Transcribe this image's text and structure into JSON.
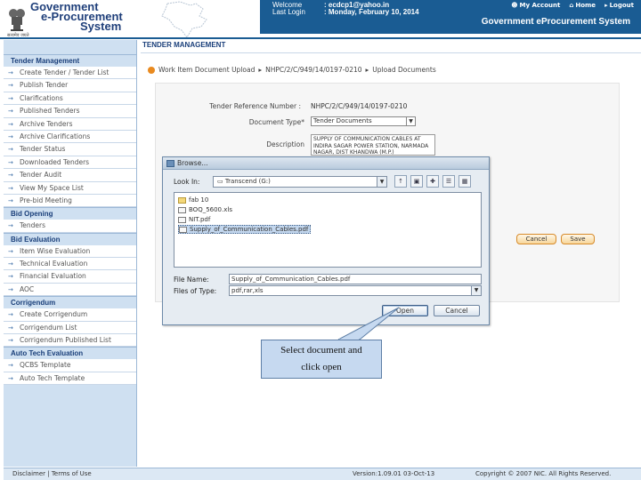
{
  "header": {
    "title_line1": "Government",
    "title_line2": "e-Procurement",
    "title_line3": "System",
    "emblem_caption": "सत्यमेव जयते",
    "welcome_label": "Welcome",
    "welcome_value": ": ecdcp1@yahoo.in",
    "lastlogin_label": "Last Login",
    "lastlogin_value": ": Monday, February 10, 2014",
    "my_account": "My Account",
    "home": "Home",
    "logout": "Logout",
    "system_title": "Government eProcurement System"
  },
  "sidebar": {
    "sections": [
      {
        "title": "Tender Management",
        "items": [
          "Create Tender / Tender List",
          "Publish Tender",
          "Clarifications",
          "Published Tenders",
          "Archive Tenders",
          "Archive Clarifications",
          "Tender Status",
          "Downloaded Tenders",
          "Tender Audit",
          "View My Space List",
          "Pre-bid Meeting"
        ]
      },
      {
        "title": "Bid Opening",
        "items": [
          "Tenders"
        ]
      },
      {
        "title": "Bid Evaluation",
        "items": [
          "Item Wise Evaluation",
          "Technical Evaluation",
          "Financial Evaluation",
          "AOC"
        ]
      },
      {
        "title": "Corrigendum",
        "items": [
          "Create Corrigendum",
          "Corrigendum List",
          "Corrigendum Published List"
        ]
      },
      {
        "title": "Auto Tech Evaluation",
        "items": [
          "QCBS Template",
          "Auto Tech Template"
        ]
      }
    ]
  },
  "main": {
    "section_title": "TENDER MANAGEMENT",
    "breadcrumb": [
      "Work Item Document Upload",
      "NHPC/2/C/949/14/0197-0210",
      "Upload Documents"
    ],
    "tender_ref_label": "Tender Reference Number :",
    "tender_ref_value": "NHPC/2/C/949/14/0197-0210",
    "doc_type_label": "Document Type*",
    "doc_type_value": "Tender Documents",
    "description_label": "Description",
    "description_value": "SUPPLY OF COMMUNICATION CABLES AT INDIRA SAGAR POWER STATION, NARMADA NAGAR, DIST KHANDWA (M.P.)",
    "cancel_label": "Cancel",
    "save_label": "Save"
  },
  "dialog": {
    "title": "Browse...",
    "look_in_label": "Look In:",
    "look_in_value": "Transcend (G:)",
    "files": [
      "fab 10",
      "BOQ_5600.xls",
      "NIT.pdf",
      "Supply_of_Communication_Cables.pdf"
    ],
    "file_name_label": "File Name:",
    "file_name_value": "Supply_of_Communication_Cables.pdf",
    "files_of_type_label": "Files of Type:",
    "files_of_type_value": "pdf,rar,xls",
    "open_label": "Open",
    "cancel_label": "Cancel"
  },
  "callout": {
    "line1": "Select document and",
    "line2": "click open"
  },
  "footer": {
    "links": "Disclaimer  |  Terms of Use",
    "version": "Version:1.09.01 03-Oct-13",
    "copyright": "Copyright © 2007 NIC. All Rights Reserved."
  },
  "colors": {
    "header_blue": "#1a5c93",
    "sidebar_bg": "#cfe0f1",
    "accent_orange": "#e98a1f",
    "callout_bg": "#c6d9f0"
  }
}
